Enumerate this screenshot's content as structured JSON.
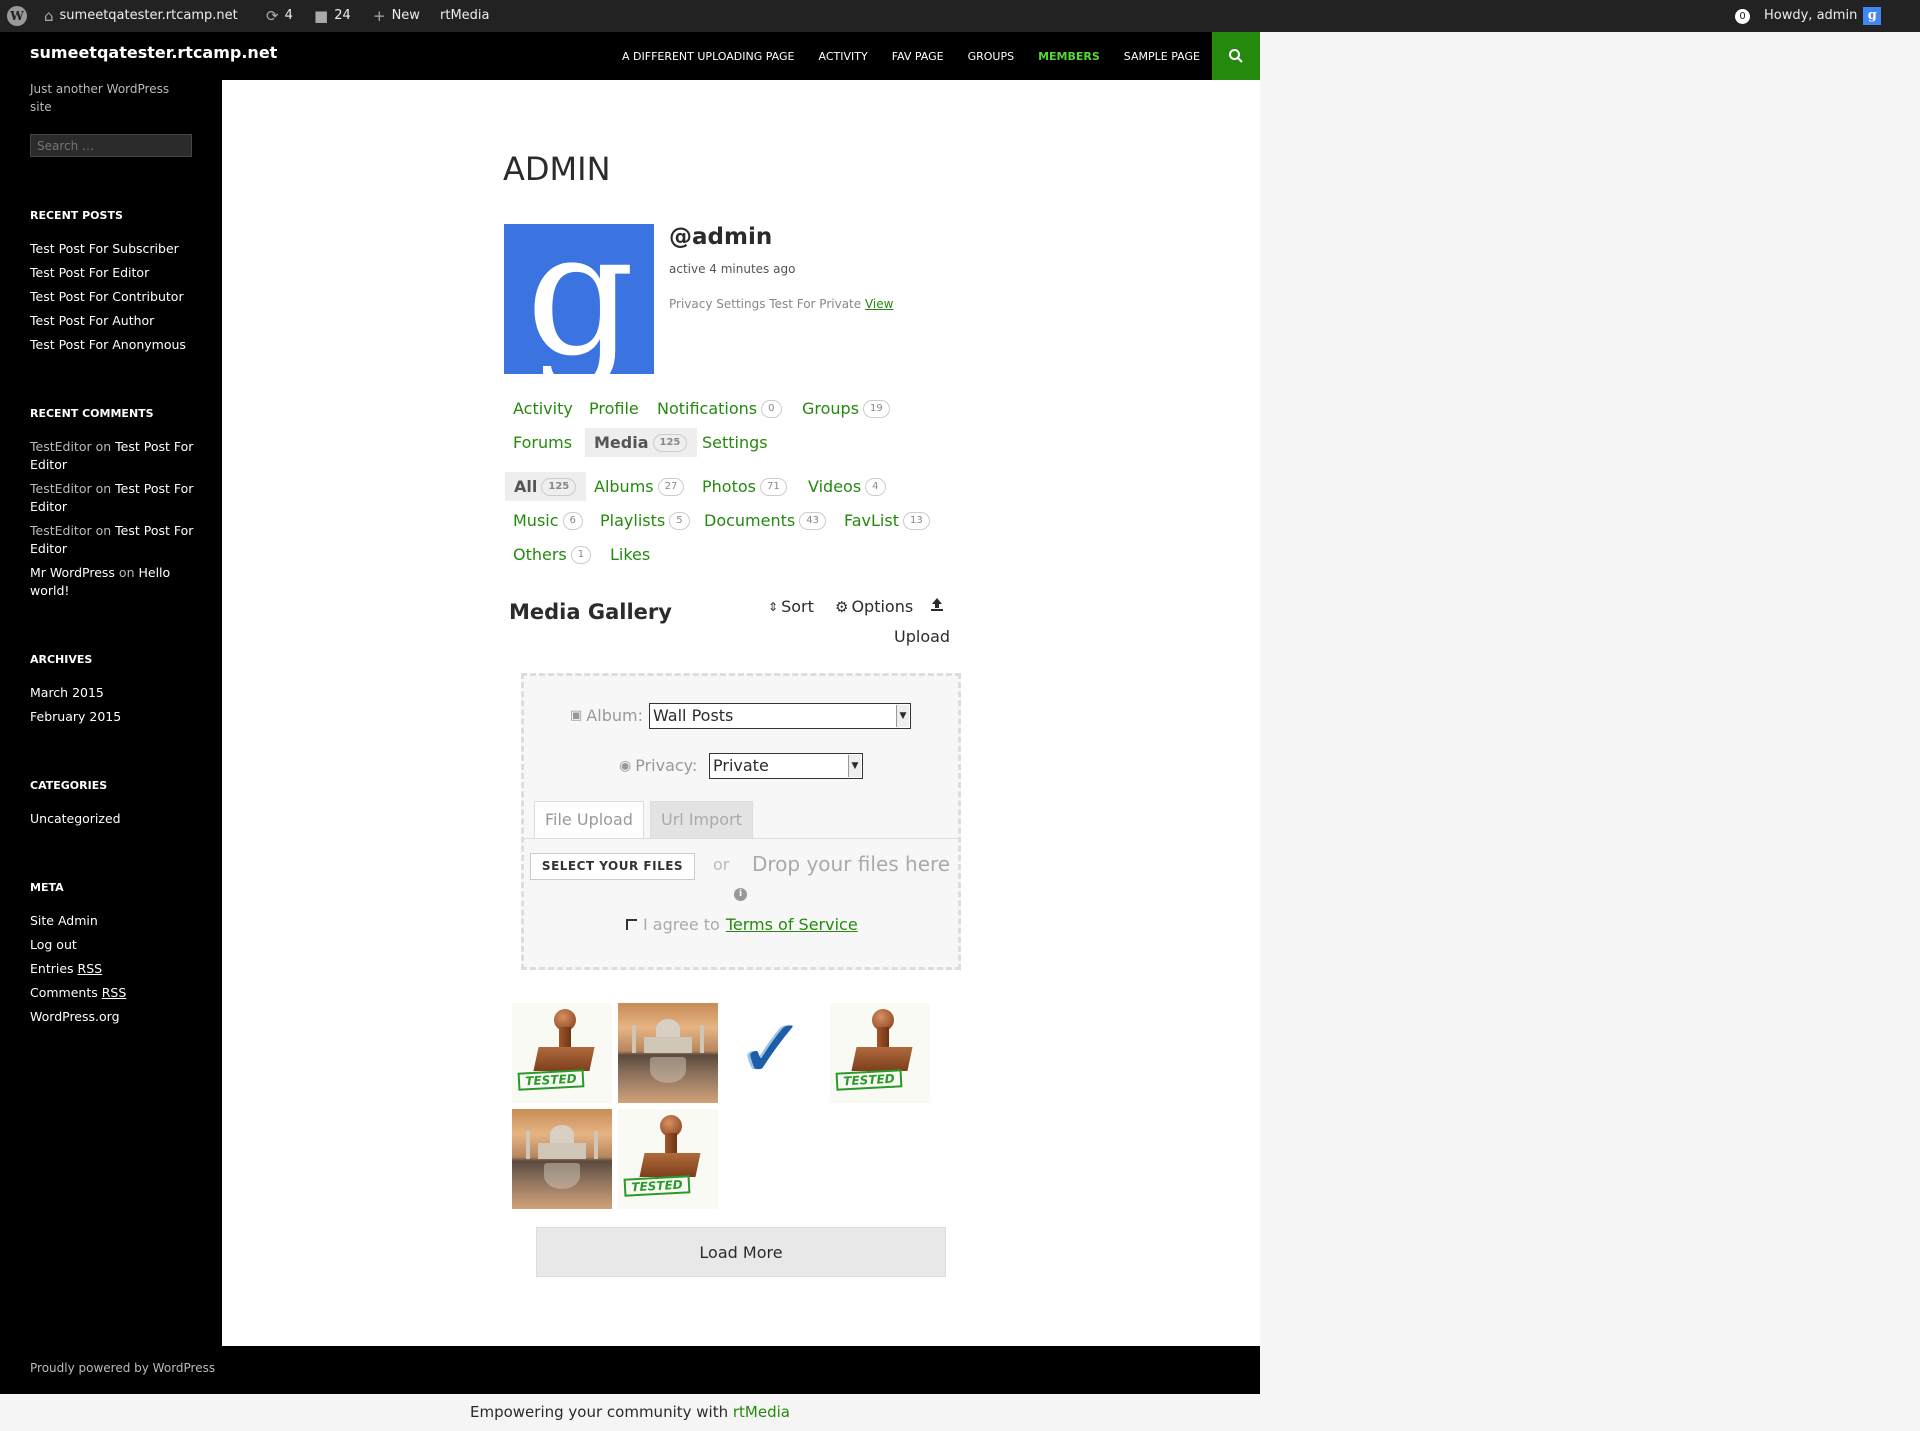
{
  "adminbar": {
    "site": "sumeetqatester.rtcamp.net",
    "updates": "4",
    "comments": "24",
    "new": "New",
    "rtmedia": "rtMedia",
    "notif_count": "0",
    "howdy": "Howdy, admin"
  },
  "header": {
    "site_title": "sumeetqatester.rtcamp.net",
    "nav": [
      "A DIFFERENT UPLOADING PAGE",
      "ACTIVITY",
      "FAV PAGE",
      "GROUPS",
      "MEMBERS",
      "SAMPLE PAGE"
    ]
  },
  "sidebar": {
    "tagline": "Just another WordPress site",
    "search_placeholder": "Search …",
    "recent_posts_title": "RECENT POSTS",
    "recent_posts": [
      "Test Post For Subscriber",
      "Test Post For Editor",
      "Test Post For Contributor",
      "Test Post For Author",
      "Test Post For Anonymous"
    ],
    "recent_comments_title": "RECENT COMMENTS",
    "recent_comments": [
      {
        "author": "TestEditor",
        "on": "on",
        "post": "Test Post For Editor"
      },
      {
        "author": "TestEditor",
        "on": "on",
        "post": "Test Post For Editor"
      },
      {
        "author": "TestEditor",
        "on": "on",
        "post": "Test Post For Editor"
      },
      {
        "author": "Mr WordPress",
        "on": "on",
        "post": "Hello world!"
      }
    ],
    "archives_title": "ARCHIVES",
    "archives": [
      "March 2015",
      "February 2015"
    ],
    "categories_title": "CATEGORIES",
    "categories": [
      "Uncategorized"
    ],
    "meta_title": "META",
    "meta": {
      "site_admin": "Site Admin",
      "log_out": "Log out",
      "entries": "Entries",
      "comments": "Comments",
      "rss": "RSS",
      "wordpress_org": "WordPress.org"
    }
  },
  "profile": {
    "page_title": "ADMIN",
    "handle": "@admin",
    "active": "active 4 minutes ago",
    "privacy_text": "Privacy Settings Test For Private",
    "privacy_link": "View",
    "tabs": {
      "activity": "Activity",
      "profile": "Profile",
      "notifications": "Notifications",
      "notifications_count": "0",
      "groups": "Groups",
      "groups_count": "19",
      "forums": "Forums",
      "media": "Media",
      "media_count": "125",
      "settings": "Settings"
    },
    "subtabs": {
      "all": "All",
      "all_count": "125",
      "albums": "Albums",
      "albums_count": "27",
      "photos": "Photos",
      "photos_count": "71",
      "videos": "Videos",
      "videos_count": "4",
      "music": "Music",
      "music_count": "6",
      "playlists": "Playlists",
      "playlists_count": "5",
      "documents": "Documents",
      "documents_count": "43",
      "favlist": "FavList",
      "favlist_count": "13",
      "others": "Others",
      "others_count": "1",
      "likes": "Likes"
    }
  },
  "gallery": {
    "title": "Media Gallery",
    "sort": "Sort",
    "options": "Options",
    "upload": "Upload",
    "album_label": "Album:",
    "album_value": "Wall Posts",
    "privacy_label": "Privacy:",
    "privacy_value": "Private",
    "file_upload_tab": "File Upload",
    "url_import_tab": "Url Import",
    "select_files": "SELECT YOUR FILES",
    "or": "or",
    "drop": "Drop your files here",
    "agree": "I agree to",
    "terms": "Terms of Service",
    "thumb_labels": [
      "TESTED",
      "TESTED",
      "TESTED"
    ],
    "load_more": "Load More"
  },
  "footer": {
    "powered": "Proudly powered by WordPress",
    "empowering": "Empowering your community with",
    "rtmedia": "rtMedia"
  },
  "colors": {
    "accent": "#24890d",
    "active_nav": "#55d737",
    "black": "#000000"
  }
}
